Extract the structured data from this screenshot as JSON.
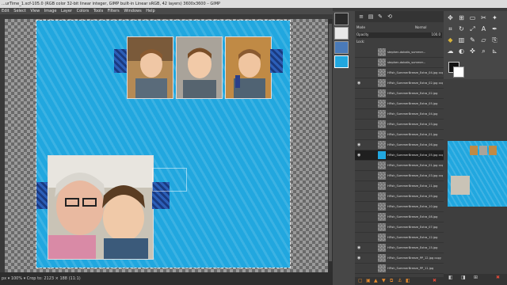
{
  "window": {
    "title": "...urTime_1.xcf-105.0 (RGB color 32-bit linear integer, GIMP built-in Linear sRGB, 42 layers) 3600x3600 – GIMP"
  },
  "menu": [
    "Edit",
    "Select",
    "View",
    "Image",
    "Layer",
    "Colors",
    "Tools",
    "Filters",
    "Windows",
    "Help"
  ],
  "status": {
    "text": "px  ▾   100%  ▾   Crop to: 2123 × 188 (11:1)"
  },
  "layers_panel": {
    "mode_label": "Mode",
    "mode_value": "Normal",
    "opacity_label": "Opacity",
    "opacity_value": "100.0",
    "lock_label": "Lock:",
    "items": [
      {
        "name": "stephen-dokalis_summer...",
        "visible": false,
        "selected": false
      },
      {
        "name": "stephen-dokalis_summer...",
        "visible": false,
        "selected": false
      },
      {
        "name": "HFish_SummerBreeze_Extra_04.jpg copy",
        "visible": false,
        "selected": false
      },
      {
        "name": "HFish_SummerBreeze_Extra_02.jpg copy",
        "visible": true,
        "selected": false
      },
      {
        "name": "HFish_SummerBreeze_Extra_02.jpg",
        "visible": false,
        "selected": false
      },
      {
        "name": "HFish_SummerBreeze_Extra_05.jpg",
        "visible": false,
        "selected": false
      },
      {
        "name": "HFish_SummerBreeze_Extra_04.jpg",
        "visible": false,
        "selected": false
      },
      {
        "name": "HFish_SummerBreeze_Extra_03.jpg",
        "visible": false,
        "selected": false
      },
      {
        "name": "HFish_SummerBreeze_Extra_01.jpg",
        "visible": false,
        "selected": false
      },
      {
        "name": "HFish_SummerBreeze_Extra_06.jpg",
        "visible": true,
        "selected": false
      },
      {
        "name": "HFish_SummerBreeze_Extra_05.jpg copy",
        "visible": true,
        "selected": true
      },
      {
        "name": "HFish_SummerBreeze_Extra_01.jpg copy",
        "visible": false,
        "selected": false
      },
      {
        "name": "HFish_SummerBreeze_Extra_03.jpg copy",
        "visible": false,
        "selected": false
      },
      {
        "name": "HFish_SummerBreeze_Extra_11.jpg",
        "visible": false,
        "selected": false
      },
      {
        "name": "HFish_SummerBreeze_Extra_09.jpg",
        "visible": false,
        "selected": false
      },
      {
        "name": "HFish_SummerBreeze_Extra_10.jpg",
        "visible": false,
        "selected": false
      },
      {
        "name": "HFish_SummerBreeze_Extra_08.jpg",
        "visible": false,
        "selected": false
      },
      {
        "name": "HFish_SummerBreeze_Extra_07.jpg",
        "visible": false,
        "selected": false
      },
      {
        "name": "HFish_SummerBreeze_Extra_12.jpg",
        "visible": false,
        "selected": false
      },
      {
        "name": "HFish_SummerBreeze_Extra_15.jpg",
        "visible": true,
        "selected": false
      },
      {
        "name": "HFish_SummerBreeze_PP_12.jpg copy",
        "visible": true,
        "selected": false
      },
      {
        "name": "HFish_SummerBreeze_PP_11.jpg",
        "visible": false,
        "selected": false
      }
    ]
  },
  "colors": {
    "accent": "#21a7df",
    "gimp_dark": "#3e3e3e",
    "selected_row": "#1f1f1f"
  }
}
